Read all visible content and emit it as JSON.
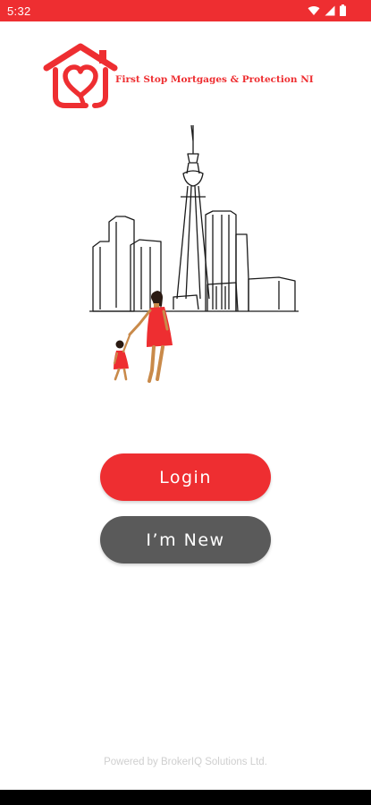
{
  "status_bar": {
    "time": "5:32",
    "background": "#ee2e31",
    "icons": [
      "wifi-icon",
      "cellular-signal-icon",
      "battery-icon"
    ]
  },
  "brand": {
    "name": "First Stop Mortgages & Protection NI",
    "color": "#ee2e31",
    "logo_icon": "house-heart-icon"
  },
  "illustration": {
    "description_icon": "city-skyline-with-mother-and-child-icon"
  },
  "actions": {
    "login_label": "Login",
    "login_color": "#ee2e31",
    "new_label": "I’m New",
    "new_color": "#5a5a5a"
  },
  "footer": {
    "powered_by": "Powered by BrokerIQ Solutions Ltd."
  }
}
